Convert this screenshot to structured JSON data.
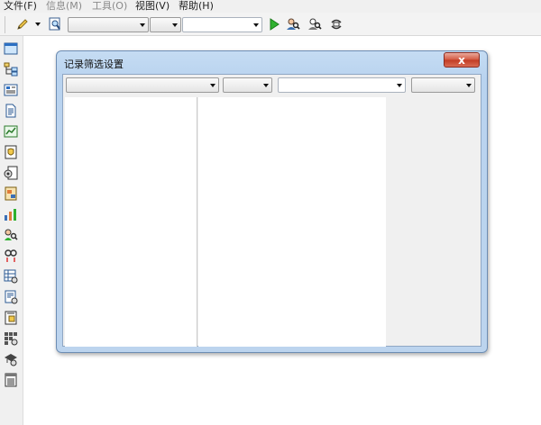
{
  "menu": {
    "items": [
      {
        "label": "文件(F)",
        "enabled": true
      },
      {
        "label": "信息(M)",
        "enabled": false
      },
      {
        "label": "工具(O)",
        "enabled": false
      },
      {
        "label": "视图(V)",
        "enabled": true
      },
      {
        "label": "帮助(H)",
        "enabled": true
      }
    ]
  },
  "toolbar": {
    "icons": [
      "pencil-icon",
      "preview-icon",
      "play-icon",
      "find-person-icon",
      "search-person-icon",
      "refresh-link-icon"
    ],
    "combo1": {
      "value": ""
    },
    "combo2": {
      "value": ""
    },
    "combo3": {
      "value": ""
    }
  },
  "sidebar": {
    "icons": [
      "window-icon",
      "tree-icon",
      "form-icon",
      "document-icon",
      "chart-icon",
      "shield-doc-icon",
      "gear-doc-icon",
      "image-doc-icon",
      "stats-icon",
      "user-search-icon",
      "link-icon",
      "table-gear-icon",
      "gear-page-icon",
      "page-star-icon",
      "grid-icon",
      "hat-gear-icon",
      "list-doc-icon"
    ]
  },
  "dialog": {
    "title": "记录筛选设置",
    "close_label": "x",
    "filters": [
      {
        "value": ""
      },
      {
        "value": ""
      },
      {
        "value": ""
      },
      {
        "value": ""
      }
    ]
  },
  "colors": {
    "accent": "#3b6fb6",
    "dialog_frame": "#bcd4ee",
    "close_red": "#c94a33"
  }
}
